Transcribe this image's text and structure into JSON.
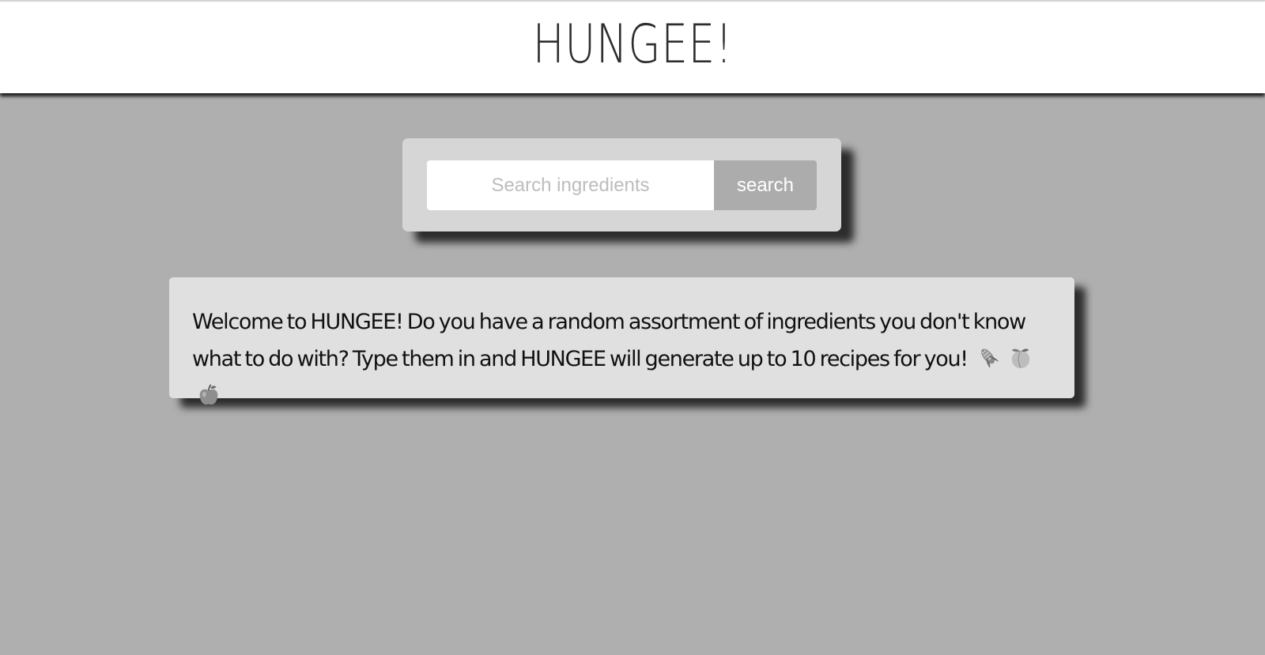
{
  "header": {
    "title": "HUNGEE!"
  },
  "search": {
    "placeholder": "Search ingredients",
    "value": "",
    "button_label": "search"
  },
  "welcome": {
    "text": "Welcome to HUNGEE! Do you have a random assortment of ingredients you don't know what to do with? Type them in and HUNGEE will generate up to 10 recipes for you!",
    "emoji_icons": [
      "corn-icon",
      "peach-icon",
      "apple-icon"
    ]
  },
  "colors": {
    "page_background": "#afafaf",
    "header_background": "#ffffff",
    "search_card": "#d6d6d6",
    "search_button": "#acacac",
    "welcome_card": "#e0e0e0"
  }
}
